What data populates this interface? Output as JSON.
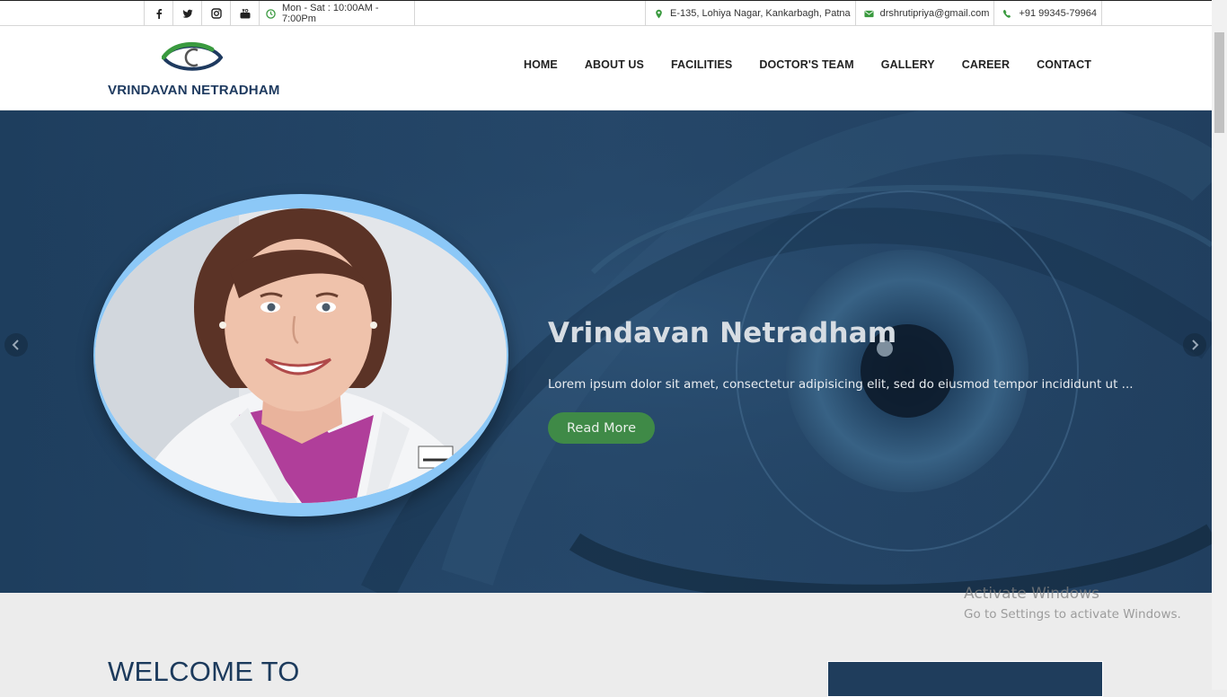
{
  "topbar": {
    "social": [
      {
        "name": "facebook-icon"
      },
      {
        "name": "twitter-icon"
      },
      {
        "name": "instagram-icon"
      },
      {
        "name": "youtube-icon"
      }
    ],
    "hours": "Mon - Sat : 10:00AM - 7:00Pm",
    "address": "E-135, Lohiya Nagar, Kankarbagh, Patna",
    "email": "drshrutipriya@gmail.com",
    "phone": "+91 99345-79964"
  },
  "header": {
    "logo_text": "VRINDAVAN NETRADHAM",
    "nav": [
      "HOME",
      "ABOUT US",
      "FACILITIES",
      "DOCTOR'S TEAM",
      "GALLERY",
      "CAREER",
      "CONTACT"
    ]
  },
  "hero": {
    "title": "Vrindavan Netradham",
    "text": "Lorem ipsum dolor sit amet, consectetur adipisicing elit, sed do eiusmod tempor incididunt ut ...",
    "button": "Read More",
    "prev_icon": "chevron-left-icon",
    "next_icon": "chevron-right-icon"
  },
  "welcome": {
    "heading": "WELCOME TO"
  },
  "watermark": {
    "line1": "Activate Windows",
    "line2": "Go to Settings to activate Windows."
  },
  "colors": {
    "brand_navy": "#1e3a5f",
    "brand_green": "#3a9a3f",
    "hero_bg": "#1e3e5e",
    "button_green": "#3f8a47",
    "portrait_ring": "#8cc8f7"
  }
}
